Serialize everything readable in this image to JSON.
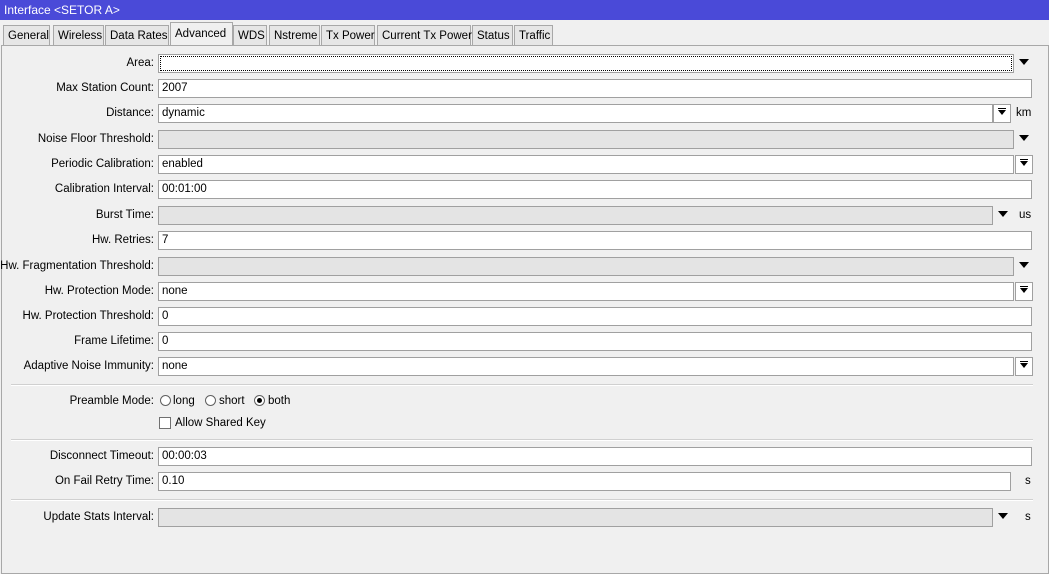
{
  "window": {
    "title": "Interface <SETOR A>"
  },
  "tabs": [
    "General",
    "Wireless",
    "Data Rates",
    "Advanced",
    "WDS",
    "Nstreme",
    "Tx Power",
    "Current Tx Power",
    "Status",
    "Traffic"
  ],
  "active_tab": "Advanced",
  "fields": {
    "area": {
      "label": "Area:",
      "value": ""
    },
    "max_station_count": {
      "label": "Max Station Count:",
      "value": "2007"
    },
    "distance": {
      "label": "Distance:",
      "value": "dynamic",
      "unit": "km"
    },
    "noise_floor_threshold": {
      "label": "Noise Floor Threshold:",
      "value": ""
    },
    "periodic_calibration": {
      "label": "Periodic Calibration:",
      "value": "enabled"
    },
    "calibration_interval": {
      "label": "Calibration Interval:",
      "value": "00:01:00"
    },
    "burst_time": {
      "label": "Burst Time:",
      "value": "",
      "unit": "us"
    },
    "hw_retries": {
      "label": "Hw. Retries:",
      "value": "7"
    },
    "hw_fragmentation_threshold": {
      "label": "Hw. Fragmentation Threshold:",
      "value": ""
    },
    "hw_protection_mode": {
      "label": "Hw. Protection Mode:",
      "value": "none"
    },
    "hw_protection_threshold": {
      "label": "Hw. Protection Threshold:",
      "value": "0"
    },
    "frame_lifetime": {
      "label": "Frame Lifetime:",
      "value": "0"
    },
    "adaptive_noise_immunity": {
      "label": "Adaptive Noise Immunity:",
      "value": "none"
    },
    "preamble_mode": {
      "label": "Preamble Mode:",
      "options": [
        "long",
        "short",
        "both"
      ],
      "selected": "both"
    },
    "allow_shared_key": {
      "label": "Allow Shared Key",
      "checked": false
    },
    "disconnect_timeout": {
      "label": "Disconnect Timeout:",
      "value": "00:00:03"
    },
    "on_fail_retry_time": {
      "label": "On Fail Retry Time:",
      "value": "0.10",
      "unit": "s"
    },
    "update_stats_interval": {
      "label": "Update Stats Interval:",
      "value": "",
      "unit": "s"
    }
  },
  "colors": {
    "titlebar": "#4a4ad8",
    "background": "#f0f0f0"
  }
}
